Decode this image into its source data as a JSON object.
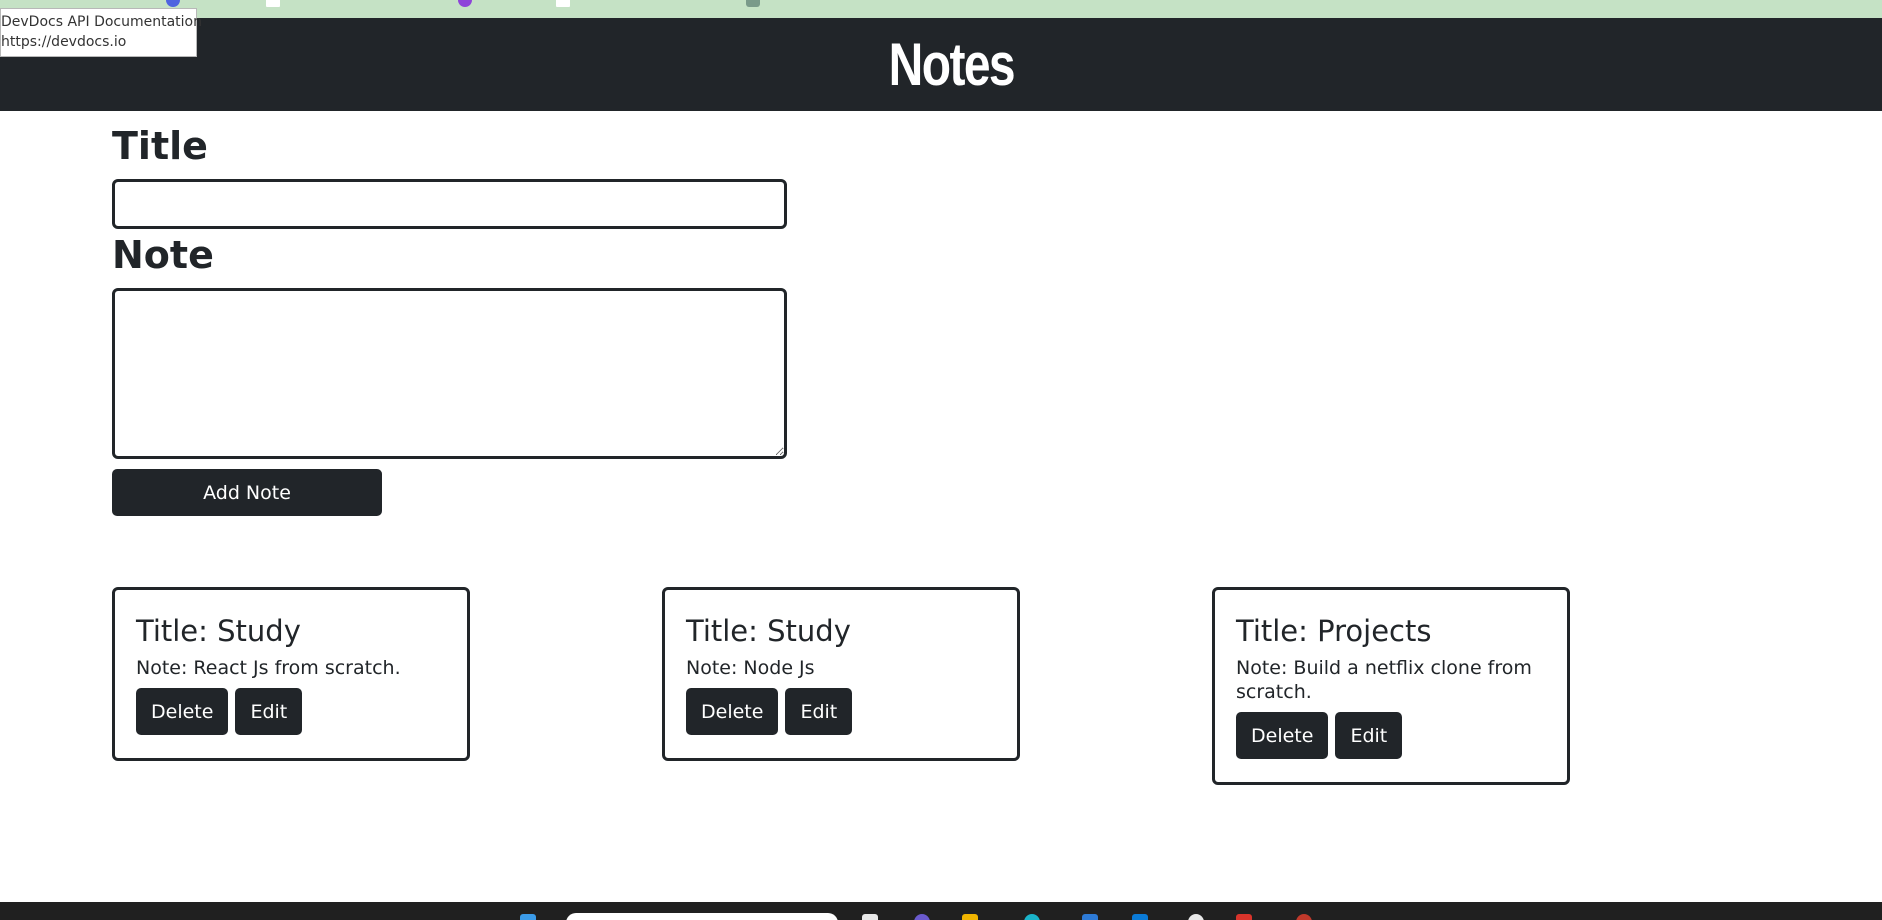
{
  "tooltip": {
    "title": "DevDocs API Documentation",
    "url": "https://devdocs.io"
  },
  "header": {
    "title": "Notes"
  },
  "form": {
    "title_label": "Title",
    "title_value": "",
    "note_label": "Note",
    "note_value": "",
    "add_button": "Add Note"
  },
  "notes": [
    {
      "title": "Title: Study",
      "note": "Note: React Js from scratch.",
      "delete_label": "Delete",
      "edit_label": "Edit"
    },
    {
      "title": "Title: Study",
      "note": "Note: Node Js",
      "delete_label": "Delete",
      "edit_label": "Edit"
    },
    {
      "title": "Title: Projects",
      "note": "Note: Build a netflix clone from scratch.",
      "delete_label": "Delete",
      "edit_label": "Edit"
    }
  ],
  "colors": {
    "dark": "#212529",
    "browser_strip": "#c5e2c5",
    "taskbar": "#202020"
  }
}
